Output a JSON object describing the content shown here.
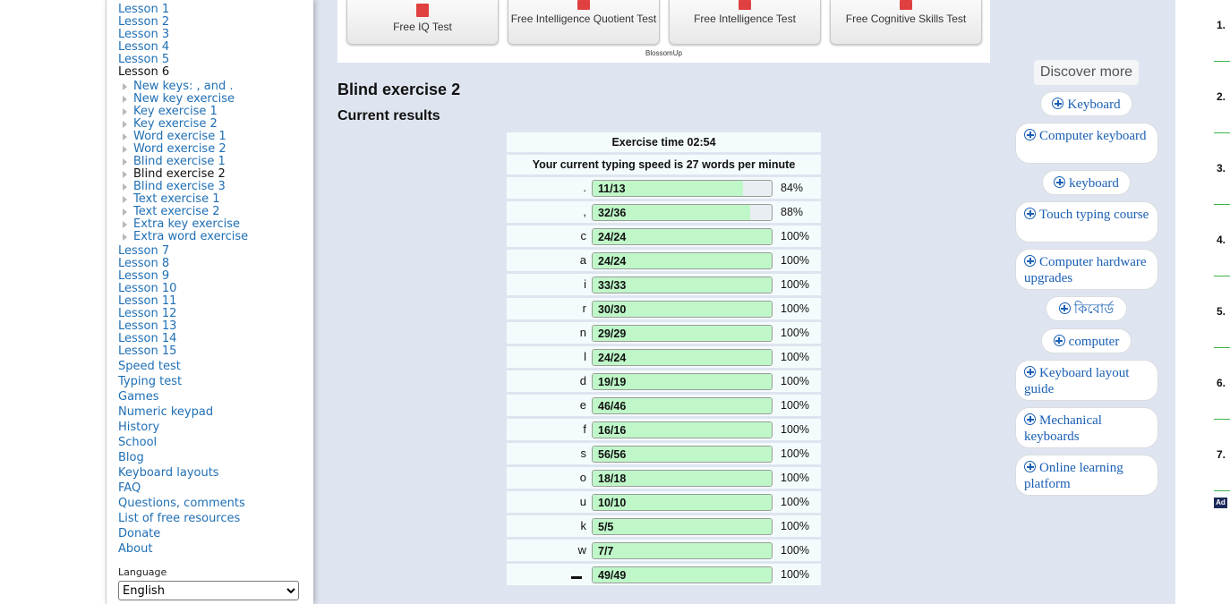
{
  "sidebar": {
    "lessons_top": [
      "Lesson 1",
      "Lesson 2",
      "Lesson 3",
      "Lesson 4",
      "Lesson 5"
    ],
    "current_lesson": "Lesson 6",
    "sub_items": [
      "New keys: , and .",
      "New key exercise",
      "Key exercise 1",
      "Key exercise 2",
      "Word exercise 1",
      "Word exercise 2",
      "Blind exercise 1",
      "Blind exercise 2",
      "Blind exercise 3",
      "Text exercise 1",
      "Text exercise 2",
      "Extra key exercise",
      "Extra word exercise"
    ],
    "current_sub_index": 7,
    "lessons_bottom": [
      "Lesson 7",
      "Lesson 8",
      "Lesson 9",
      "Lesson 10",
      "Lesson 11",
      "Lesson 12",
      "Lesson 13",
      "Lesson 14",
      "Lesson 15"
    ],
    "links": [
      "Speed test",
      "Typing test",
      "Games",
      "Numeric keypad",
      "History",
      "School",
      "Blog",
      "Keyboard layouts",
      "FAQ",
      "Questions, comments",
      "List of free resources",
      "Donate",
      "About"
    ],
    "language_label": "Language",
    "language_value": "English"
  },
  "ad": {
    "buttons": [
      "Free IQ Test",
      "Free Intelligence Quotient Test",
      "Free Intelligence Test",
      "Free Cognitive Skills Test"
    ],
    "brand": "BlossomUp"
  },
  "page": {
    "title": "Blind exercise 2",
    "subtitle": "Current results"
  },
  "results": {
    "exercise_time": "Exercise time 02:54",
    "speed_text": "Your current typing speed is 27 words per minute",
    "rows": [
      {
        "key": ".",
        "score": "11/13",
        "fraction": 0.84,
        "percent": "84%"
      },
      {
        "key": ",",
        "score": "32/36",
        "fraction": 0.88,
        "percent": "88%"
      },
      {
        "key": "c",
        "score": "24/24",
        "fraction": 1,
        "percent": "100%"
      },
      {
        "key": "a",
        "score": "24/24",
        "fraction": 1,
        "percent": "100%"
      },
      {
        "key": "i",
        "score": "33/33",
        "fraction": 1,
        "percent": "100%"
      },
      {
        "key": "r",
        "score": "30/30",
        "fraction": 1,
        "percent": "100%"
      },
      {
        "key": "n",
        "score": "29/29",
        "fraction": 1,
        "percent": "100%"
      },
      {
        "key": "l",
        "score": "24/24",
        "fraction": 1,
        "percent": "100%"
      },
      {
        "key": "d",
        "score": "19/19",
        "fraction": 1,
        "percent": "100%"
      },
      {
        "key": "e",
        "score": "46/46",
        "fraction": 1,
        "percent": "100%"
      },
      {
        "key": "f",
        "score": "16/16",
        "fraction": 1,
        "percent": "100%"
      },
      {
        "key": "s",
        "score": "56/56",
        "fraction": 1,
        "percent": "100%"
      },
      {
        "key": "o",
        "score": "18/18",
        "fraction": 1,
        "percent": "100%"
      },
      {
        "key": "u",
        "score": "10/10",
        "fraction": 1,
        "percent": "100%"
      },
      {
        "key": "k",
        "score": "5/5",
        "fraction": 1,
        "percent": "100%"
      },
      {
        "key": "w",
        "score": "7/7",
        "fraction": 1,
        "percent": "100%"
      },
      {
        "key": "",
        "score": "49/49",
        "fraction": 1,
        "percent": "100%"
      }
    ]
  },
  "discover": {
    "title": "Discover more",
    "items": [
      "Keyboard",
      "Computer keyboard",
      "keyboard",
      "Touch typing course",
      "Computer hardware upgrades",
      "কিবোর্ড",
      "computer",
      "Keyboard layout guide",
      "Mechanical keyboards",
      "Online learning platform"
    ]
  },
  "right_rail": {
    "ranks": [
      "1.",
      "2.",
      "3.",
      "4.",
      "5.",
      "6.",
      "7."
    ],
    "ad_label": "Ad"
  },
  "colors": {
    "link": "#1f6fb5",
    "bar_fill": "#bff7c8",
    "page_bg": "#dfe5f0"
  }
}
